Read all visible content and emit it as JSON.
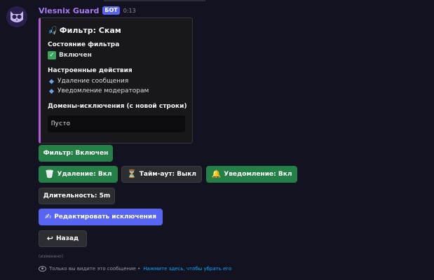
{
  "message": {
    "username": "Vlesnix Guard",
    "bot_badge": "БОТ",
    "time": "0:13"
  },
  "embed": {
    "title": "Фильтр: Скам",
    "title_icon": "fishing-icon",
    "accent_color": "#b15bd6",
    "fields": {
      "status_label": "Состояние фильтра",
      "status_value": "Включен",
      "actions_label": "Настроенные действия",
      "actions": [
        "Удаление сообщения",
        "Уведомление модераторам"
      ],
      "domains_label": "Домены-исключения (с новой строки)",
      "domains_value": "Пусто"
    }
  },
  "buttons": {
    "filter": "Фильтр: Включен",
    "delete": "Удаление: Вкл",
    "timeout": "Тайм-аут: Выкл",
    "notify": "Уведомление: Вкл",
    "duration": "Длительность: 5m",
    "edit_exceptions": "Редактировать исключения",
    "back": "Назад"
  },
  "icons": {
    "delete": "wastebasket-icon",
    "timeout": "hourglass-icon",
    "notify": "bell-icon",
    "edit": "writing-hand-icon",
    "back": "return-arrow-icon"
  },
  "colors": {
    "green": "#248046",
    "grey": "#2b2d31",
    "blurple": "#5865f2",
    "link": "#00a8fc"
  },
  "edited": "(изменено)",
  "footer": {
    "prefix": "Только вы видите это сообщение •",
    "link": "Нажмите здесь, чтобы убрать его"
  }
}
